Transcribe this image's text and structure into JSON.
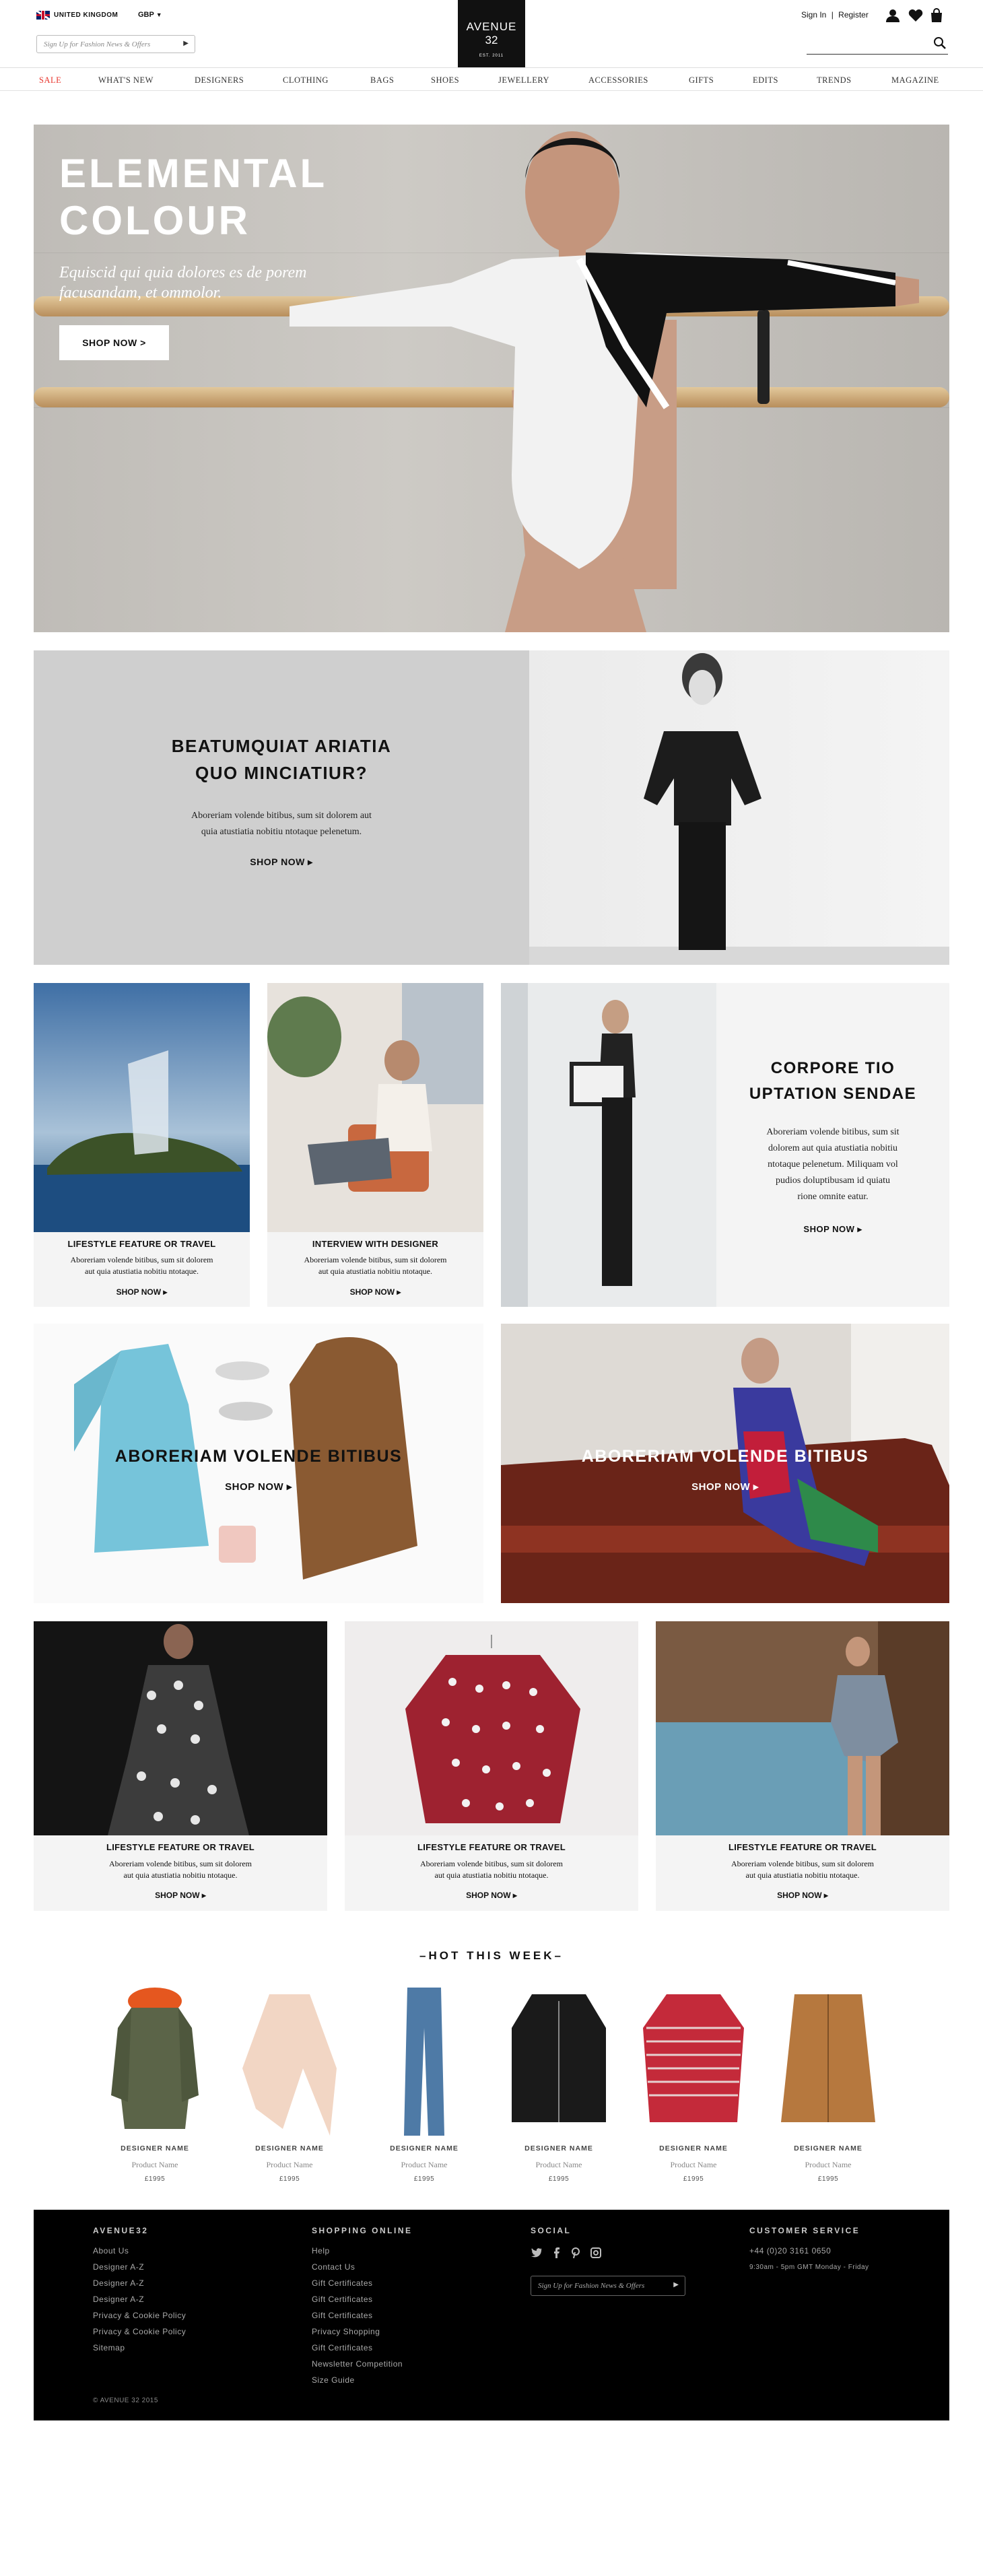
{
  "header": {
    "country": "UNITED KINGDOM",
    "currency": "GBP",
    "signup_placeholder": "Sign Up for Fashion News & Offers",
    "logo": {
      "line1": "AVENUE",
      "line2": "32",
      "line3": "EST. 2011"
    },
    "sign_in": "Sign In",
    "separator": "|",
    "register": "Register",
    "icons": [
      "user-icon",
      "heart-icon",
      "bag-icon",
      "search-icon"
    ]
  },
  "nav": {
    "items": [
      "SALE",
      "WHAT'S NEW",
      "DESIGNERS",
      "CLOTHING",
      "BAGS",
      "SHOES",
      "JEWELLERY",
      "ACCESSORIES",
      "GIFTS",
      "EDITS",
      "TRENDS",
      "MAGAZINE"
    ],
    "sale_color": "#e8342c"
  },
  "hero": {
    "title_line1": "ELEMENTAL",
    "title_line2": "COLOUR",
    "subtitle": "Equiscid qui quia dolores es de porem facusandam, et ommolor.",
    "button": "SHOP NOW >"
  },
  "promo2": {
    "title_line1": "BEATUMQUIAT ARIATIA",
    "title_line2": "QUO MINCIATIUR?",
    "body_line1": "Aboreriam volende bitibus, sum sit dolorem aut",
    "body_line2": "quia atustiatia nobitiu ntotaque pelenetum.",
    "shop": "SHOP NOW ▸"
  },
  "row3": {
    "card1": {
      "title": "LIFESTYLE FEATURE OR TRAVEL",
      "body1": "Aboreriam volende bitibus, sum sit dolorem",
      "body2": "aut quia atustiatia nobitiu ntotaque.",
      "shop": "SHOP NOW ▸"
    },
    "card2": {
      "title": "INTERVIEW WITH DESIGNER",
      "body1": "Aboreriam volende bitibus, sum sit dolorem",
      "body2": "aut quia atustiatia nobitiu ntotaque.",
      "shop": "SHOP NOW ▸"
    },
    "feature": {
      "title_line1": "CORPORE TIO",
      "title_line2": "UPTATION SENDAE",
      "body1": "Aboreriam volende bitibus, sum sit",
      "body2": "dolorem aut quia atustiatia nobitiu",
      "body3": "ntotaque pelenetum. Miliquam vol",
      "body4": "pudios doluptibusam id quiatu",
      "body5": "rione omnite eatur.",
      "shop": "SHOP NOW ▸"
    }
  },
  "row4": {
    "left": {
      "title": "ABORERIAM VOLENDE BITIBUS",
      "shop": "SHOP NOW ▸"
    },
    "right": {
      "title": "ABORERIAM VOLENDE BITIBUS",
      "shop": "SHOP NOW ▸"
    }
  },
  "row5": [
    {
      "title": "LIFESTYLE FEATURE OR TRAVEL",
      "body1": "Aboreriam volende bitibus, sum sit dolorem",
      "body2": "aut quia atustiatia nobitiu ntotaque.",
      "shop": "SHOP NOW ▸"
    },
    {
      "title": "LIFESTYLE FEATURE OR TRAVEL",
      "body1": "Aboreriam volende bitibus, sum sit dolorem",
      "body2": "aut quia atustiatia nobitiu ntotaque.",
      "shop": "SHOP NOW ▸"
    },
    {
      "title": "LIFESTYLE FEATURE OR TRAVEL",
      "body1": "Aboreriam volende bitibus, sum sit dolorem",
      "body2": "aut quia atustiatia nobitiu ntotaque.",
      "shop": "SHOP NOW ▸"
    }
  ],
  "hot": {
    "heading": "–HOT THIS WEEK–",
    "products": [
      {
        "designer": "DESIGNER NAME",
        "name": "Product Name",
        "price": "£1995"
      },
      {
        "designer": "DESIGNER NAME",
        "name": "Product Name",
        "price": "£1995"
      },
      {
        "designer": "DESIGNER NAME",
        "name": "Product Name",
        "price": "£1995"
      },
      {
        "designer": "DESIGNER NAME",
        "name": "Product Name",
        "price": "£1995"
      },
      {
        "designer": "DESIGNER NAME",
        "name": "Product Name",
        "price": "£1995"
      },
      {
        "designer": "DESIGNER NAME",
        "name": "Product Name",
        "price": "£1995"
      }
    ]
  },
  "footer": {
    "col1": {
      "heading": "AVENUE32",
      "links": [
        "About Us",
        "Designer A-Z",
        "Designer A-Z",
        "Designer A-Z",
        "Privacy & Cookie Policy",
        "Privacy & Cookie Policy",
        "Sitemap"
      ]
    },
    "col2": {
      "heading": "SHOPPING ONLINE",
      "links": [
        "Help",
        "Contact Us",
        "Gift Certificates",
        "Gift Certificates",
        "Gift Certificates",
        "Privacy Shopping",
        "Gift Certificates",
        "Newsletter Competition",
        "Size Guide"
      ]
    },
    "col3": {
      "heading": "SOCIAL",
      "signup": "Sign Up for Fashion News & Offers"
    },
    "col4": {
      "heading": "CUSTOMER SERVICE",
      "phone": "+44 (0)20 3161 0650",
      "hours": "9:30am - 5pm GMT Monday - Friday"
    },
    "copyright": "© AVENUE 32 2015"
  }
}
